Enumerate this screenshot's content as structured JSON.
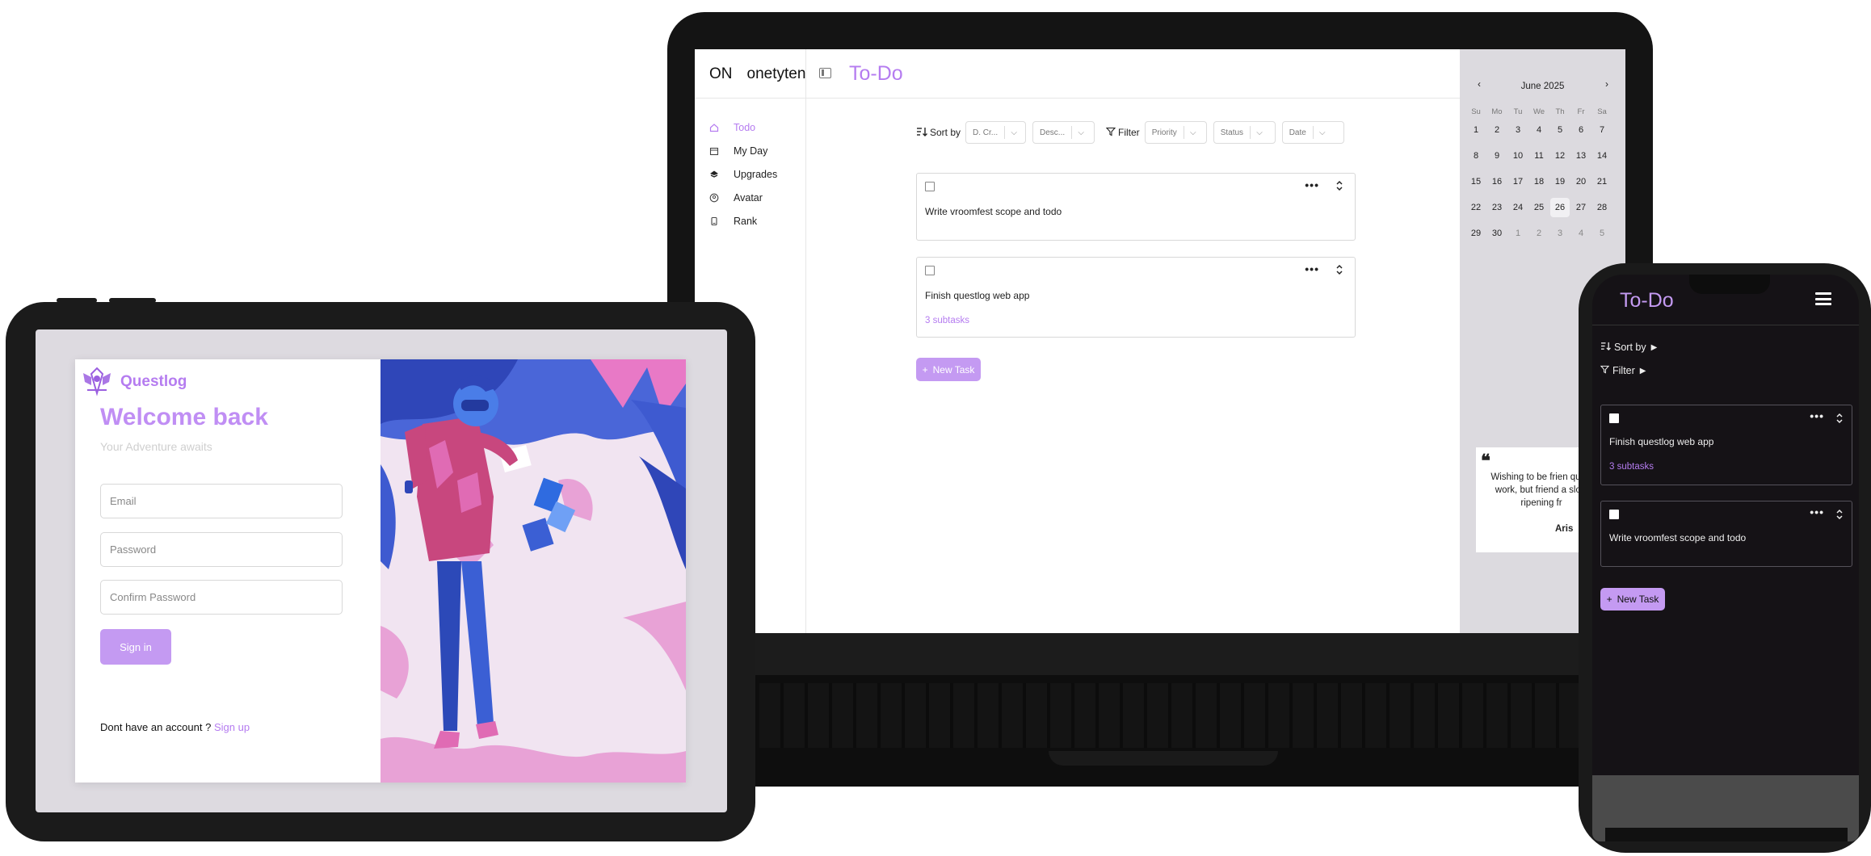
{
  "laptop": {
    "sidebar": {
      "logo_short": "ON",
      "logo_name": "onetyten",
      "items": [
        {
          "label": "Todo",
          "icon": "home-icon",
          "active": true
        },
        {
          "label": "My Day",
          "icon": "calendar-icon"
        },
        {
          "label": "Upgrades",
          "icon": "upgrades-icon"
        },
        {
          "label": "Avatar",
          "icon": "avatar-icon"
        },
        {
          "label": "Rank",
          "icon": "rank-icon"
        }
      ]
    },
    "header": {
      "title": "To-Do"
    },
    "toolbar": {
      "sort_label": "Sort by",
      "sort_field": "D. Cr...",
      "sort_order": "Desc...",
      "filter_label": "Filter",
      "filter_priority": "Priority",
      "filter_status": "Status",
      "filter_date": "Date"
    },
    "tasks": [
      {
        "title": "Write vroomfest scope and todo",
        "subtasks": ""
      },
      {
        "title": "Finish questlog web app",
        "subtasks": "3 subtasks"
      }
    ],
    "new_task_label": "New Task",
    "calendar": {
      "month": "June 2025",
      "prev": "‹",
      "next": "›",
      "weekdays": [
        "Su",
        "Mo",
        "Tu",
        "We",
        "Th",
        "Fr",
        "Sa"
      ],
      "days": [
        "1",
        "2",
        "3",
        "4",
        "5",
        "6",
        "7",
        "8",
        "9",
        "10",
        "11",
        "12",
        "13",
        "14",
        "15",
        "16",
        "17",
        "18",
        "19",
        "20",
        "21",
        "22",
        "23",
        "24",
        "25",
        "26",
        "27",
        "28",
        "29",
        "30",
        "1",
        "2",
        "3",
        "4",
        "5"
      ],
      "today": "26"
    },
    "quote": {
      "mark": "❝",
      "text": "Wishing to be frien quick work, but friend a slow ripening fr",
      "author": "Aris"
    }
  },
  "tablet": {
    "brand": "Questlog",
    "welcome": "Welcome back",
    "tagline": "Your Adventure awaits",
    "email_placeholder": "Email",
    "password_placeholder": "Password",
    "confirm_placeholder": "Confirm Password",
    "signin_label": "Sign in",
    "no_account_text": "Dont have an account ?",
    "signup_link": "Sign up"
  },
  "phone": {
    "title": "To-Do",
    "sort_label": "Sort by",
    "filter_label": "Filter",
    "tasks": [
      {
        "title": "Finish questlog web app",
        "subtasks": "3 subtasks"
      },
      {
        "title": "Write vroomfest scope and todo",
        "subtasks": ""
      }
    ],
    "new_task_label": "New Task"
  },
  "colors": {
    "accent": "#b57cf0",
    "button": "#c49af2",
    "phone_bg": "#151216",
    "calendar_bg": "#dcdadf"
  }
}
